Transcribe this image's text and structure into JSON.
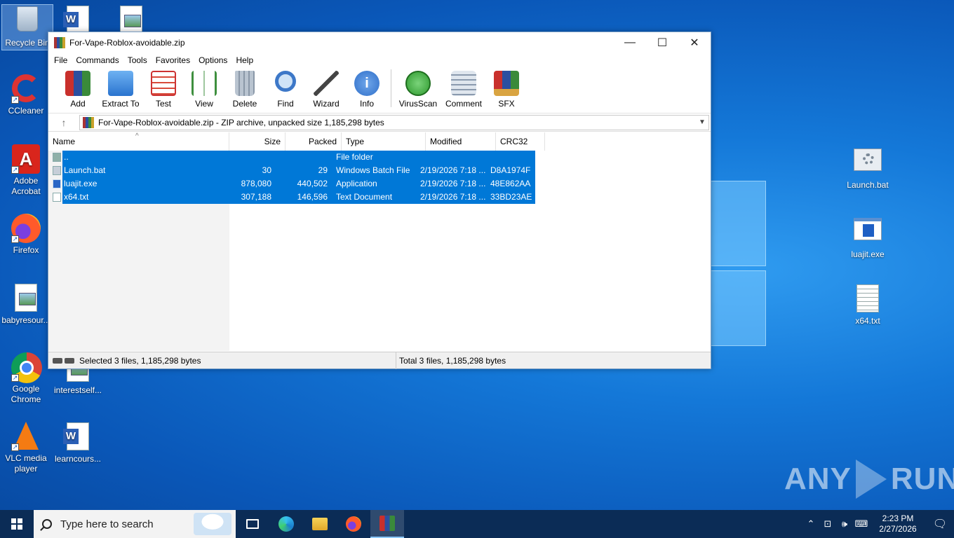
{
  "desktop": {
    "left_icons": [
      {
        "label": "Recycle Bin",
        "icon": "recycle-bin-icon",
        "selected": true
      },
      {
        "label": "CCleaner",
        "icon": "ccleaner-icon"
      },
      {
        "label": "Adobe Acrobat",
        "icon": "acrobat-icon"
      },
      {
        "label": "Firefox",
        "icon": "firefox-icon"
      },
      {
        "label": "babyresour...",
        "icon": "image-file-icon"
      },
      {
        "label": "Google Chrome",
        "icon": "chrome-icon"
      },
      {
        "label": "VLC media player",
        "icon": "vlc-icon"
      }
    ],
    "col2_icons": [
      {
        "label": "",
        "icon": "word-doc-icon"
      },
      {
        "label": "interestself...",
        "icon": "image-file-icon"
      },
      {
        "label": "learncours...",
        "icon": "word-doc-icon"
      }
    ],
    "col3_icons": [
      {
        "label": "",
        "icon": "image-file-icon"
      }
    ],
    "right_icons": [
      {
        "label": "Launch.bat",
        "icon": "batch-file-icon"
      },
      {
        "label": "luajit.exe",
        "icon": "exe-file-icon"
      },
      {
        "label": "x64.txt",
        "icon": "text-file-icon"
      }
    ]
  },
  "window": {
    "title": "For-Vape-Roblox-avoidable.zip",
    "controls": {
      "minimize": "—",
      "maximize": "☐",
      "close": "✕"
    },
    "menu": [
      "File",
      "Commands",
      "Tools",
      "Favorites",
      "Options",
      "Help"
    ],
    "toolbar": [
      {
        "label": "Add",
        "icon": "add-archive-icon",
        "color": "#c9302c"
      },
      {
        "label": "Extract To",
        "icon": "extract-folder-icon",
        "color": "#3a8ee6"
      },
      {
        "label": "Test",
        "icon": "test-checklist-icon",
        "color": "#d84a3a"
      },
      {
        "label": "View",
        "icon": "view-book-icon",
        "color": "#3e8f3e"
      },
      {
        "label": "Delete",
        "icon": "trash-icon",
        "color": "#8a98a8"
      },
      {
        "label": "Find",
        "icon": "find-magnifier-icon",
        "color": "#3d78c8"
      },
      {
        "label": "Wizard",
        "icon": "wizard-wand-icon",
        "color": "#5a5a5a"
      },
      {
        "label": "Info",
        "icon": "info-icon",
        "color": "#2f6fc9"
      },
      {
        "label": "VirusScan",
        "icon": "virus-scan-icon",
        "color": "#2f9a2f"
      },
      {
        "label": "Comment",
        "icon": "comment-icon",
        "color": "#8a9aae"
      },
      {
        "label": "SFX",
        "icon": "sfx-box-icon",
        "color": "#d9a441"
      }
    ],
    "address": "For-Vape-Roblox-avoidable.zip - ZIP archive, unpacked size 1,185,298 bytes",
    "columns": [
      "Name",
      "Size",
      "Packed",
      "Type",
      "Modified",
      "CRC32"
    ],
    "files": [
      {
        "name": "..",
        "size": "",
        "packed": "",
        "type": "File folder",
        "modified": "",
        "crc": "",
        "kind": "folder"
      },
      {
        "name": "Launch.bat",
        "size": "30",
        "packed": "29",
        "type": "Windows Batch File",
        "modified": "2/19/2026 7:18 ...",
        "crc": "D8A1974F",
        "kind": "bat"
      },
      {
        "name": "luajit.exe",
        "size": "878,080",
        "packed": "440,502",
        "type": "Application",
        "modified": "2/19/2026 7:18 ...",
        "crc": "48E862AA",
        "kind": "exe"
      },
      {
        "name": "x64.txt",
        "size": "307,188",
        "packed": "146,596",
        "type": "Text Document",
        "modified": "2/19/2026 7:18 ...",
        "crc": "33BD23AE",
        "kind": "txt"
      }
    ],
    "status_left": "Selected 3 files, 1,185,298 bytes",
    "status_right": "Total 3 files, 1,185,298 bytes"
  },
  "taskbar": {
    "search_placeholder": "Type here to search",
    "apps": [
      {
        "icon": "task-view-icon",
        "color": "#ffffff"
      },
      {
        "icon": "edge-icon",
        "color": "#1fa0e0"
      },
      {
        "icon": "file-explorer-icon",
        "color": "#f2c230"
      },
      {
        "icon": "firefox-icon",
        "color": "#ff7a1a"
      },
      {
        "icon": "winrar-icon",
        "color": "#b03a3a",
        "active": true
      }
    ],
    "time": "2:23 PM",
    "date": "2/27/2026"
  },
  "watermark": {
    "left": "ANY",
    "right": "RUN"
  }
}
